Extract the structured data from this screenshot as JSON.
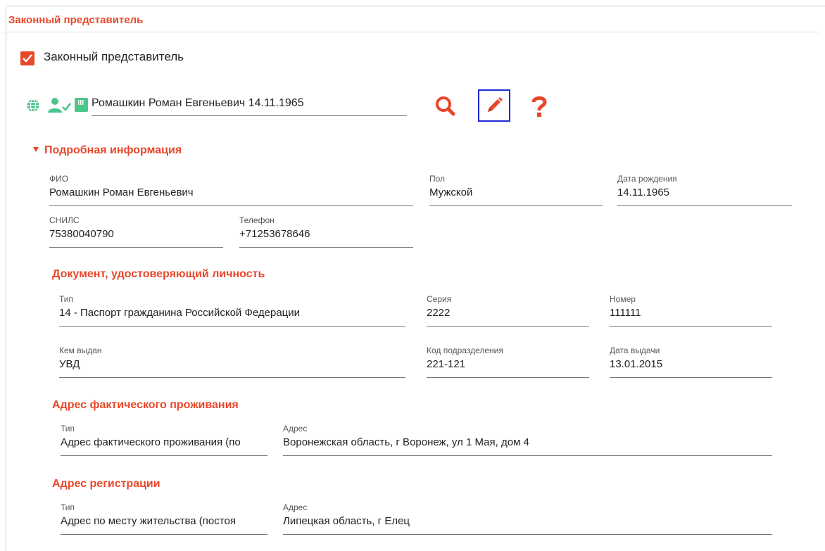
{
  "section_title": "Законный представитель",
  "checkbox": {
    "label": "Законный представитель",
    "checked": true
  },
  "person_select": {
    "value": "Ромашкин Роман Евгеньевич 14.11.1965"
  },
  "icons": [
    "globe-icon",
    "person-check-icon",
    "card-icon",
    "search-icon",
    "pencil-icon",
    "question-icon"
  ],
  "colors": {
    "accent": "#e8472a",
    "green": "#4cc58a",
    "focus": "#1f2bd6"
  },
  "details": {
    "title": "Подробная информация",
    "fio": {
      "label": "ФИО",
      "value": "Ромашкин Роман Евгеньевич"
    },
    "gender": {
      "label": "Пол",
      "value": "Мужской"
    },
    "birth_date": {
      "label": "Дата рождения",
      "value": "14.11.1965"
    },
    "snils": {
      "label": "СНИЛС",
      "value": "75380040790"
    },
    "phone": {
      "label": "Телефон",
      "value": "+71253678646"
    }
  },
  "id_document": {
    "title": "Документ, удостоверяющий личность",
    "type": {
      "label": "Тип",
      "value": "14 - Паспорт гражданина Российской Федерации"
    },
    "series": {
      "label": "Серия",
      "value": "2222"
    },
    "number": {
      "label": "Номер",
      "value": "111111"
    },
    "issued_by": {
      "label": "Кем выдан",
      "value": "УВД"
    },
    "division_code": {
      "label": "Код подразделения",
      "value": "221-121"
    },
    "issue_date": {
      "label": "Дата выдачи",
      "value": "13.01.2015"
    }
  },
  "actual_address": {
    "title": "Адрес фактического проживания",
    "type": {
      "label": "Тип",
      "value": "Адрес фактического проживания (по"
    },
    "address": {
      "label": "Адрес",
      "value": "Воронежская область, г Воронеж, ул 1 Мая, дом 4"
    }
  },
  "registration_address": {
    "title": "Адрес регистрации",
    "type": {
      "label": "Тип",
      "value": "Адрес по месту жительства (постоя"
    },
    "address": {
      "label": "Адрес",
      "value": "Липецкая область, г Елец"
    }
  }
}
